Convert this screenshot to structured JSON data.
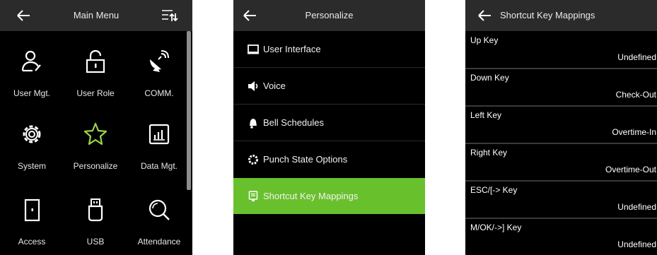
{
  "main_menu": {
    "title": "Main Menu",
    "items": [
      {
        "label": "User Mgt.",
        "icon": "user-icon"
      },
      {
        "label": "User Role",
        "icon": "lock-icon"
      },
      {
        "label": "COMM.",
        "icon": "satellite-dish-icon"
      },
      {
        "label": "System",
        "icon": "gear-icon"
      },
      {
        "label": "Personalize",
        "icon": "star-icon"
      },
      {
        "label": "Data Mgt.",
        "icon": "bar-chart-icon"
      },
      {
        "label": "Access",
        "icon": "door-icon"
      },
      {
        "label": "USB",
        "icon": "usb-drive-icon"
      },
      {
        "label": "Attendance",
        "icon": "magnifier-icon"
      }
    ]
  },
  "personalize": {
    "title": "Personalize",
    "items": [
      {
        "label": "User Interface",
        "icon": "monitor-icon"
      },
      {
        "label": "Voice",
        "icon": "speaker-icon"
      },
      {
        "label": "Bell Schedules",
        "icon": "bell-icon"
      },
      {
        "label": "Punch State Options",
        "icon": "gear-icon"
      },
      {
        "label": "Shortcut Key Mappings",
        "icon": "keypad-icon",
        "selected": true
      }
    ],
    "accent": "#69c02d"
  },
  "shortcut": {
    "title": "Shortcut Key Mappings",
    "rows": [
      {
        "key": "Up Key",
        "value": "Undefined"
      },
      {
        "key": "Down Key",
        "value": "Check-Out"
      },
      {
        "key": "Left Key",
        "value": "Overtime-In"
      },
      {
        "key": "Right Key",
        "value": "Overtime-Out"
      },
      {
        "key": "ESC/[-> Key",
        "value": "Undefined"
      },
      {
        "key": "M/OK/->] Key",
        "value": "Undefined"
      }
    ]
  }
}
